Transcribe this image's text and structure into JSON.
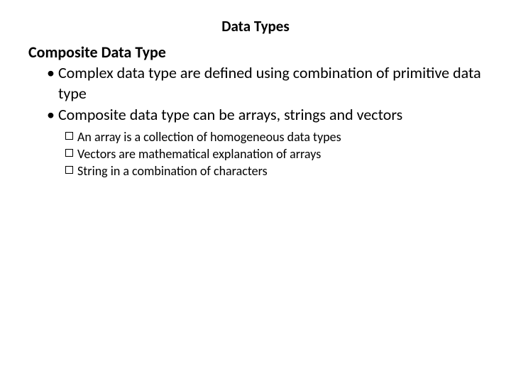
{
  "title": "Data Types",
  "subtitle": "Composite Data Type",
  "bullets": [
    "Complex data type are defined using combination of primitive data type",
    "Composite data type can be arrays, strings and vectors"
  ],
  "sub_bullets": [
    "An array is a collection of homogeneous data types",
    "Vectors are mathematical explanation of arrays",
    "String in a combination of characters"
  ]
}
